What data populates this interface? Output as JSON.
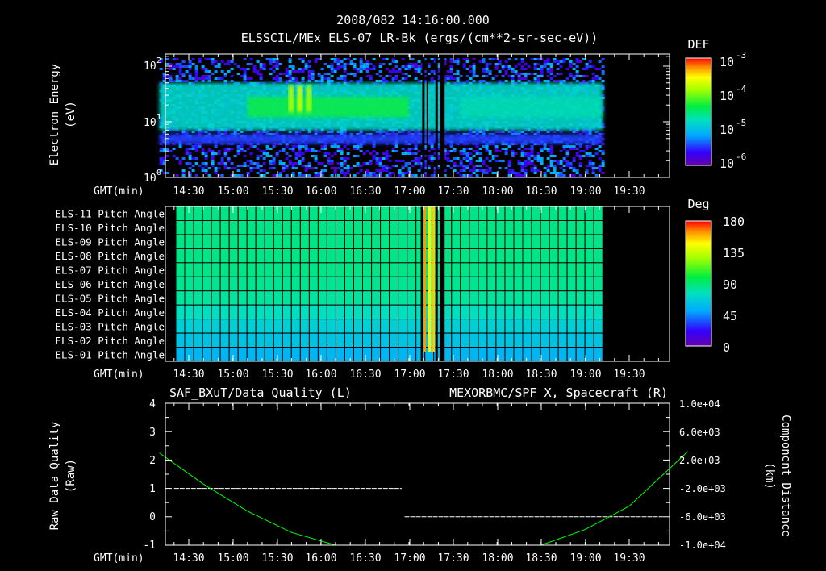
{
  "header": {
    "timestamp": "2008/082 14:16:00.000",
    "subtitle": "ELSSCIL/MEx ELS-07 LR-Bk   (ergs/(cm**2-sr-sec-eV))"
  },
  "time_axis": {
    "label": "GMT(min)",
    "ticks": [
      "14:30",
      "15:00",
      "15:30",
      "16:00",
      "16:30",
      "17:00",
      "17:30",
      "18:00",
      "18:30",
      "19:00",
      "19:30"
    ]
  },
  "panel1": {
    "ylabel_line1": "Electron Energy",
    "ylabel_line2": "(eV)",
    "yticks": [
      {
        "base": "10",
        "exp": "2"
      },
      {
        "base": "10",
        "exp": "1"
      },
      {
        "base": "10",
        "exp": "0"
      }
    ],
    "colorbar": {
      "title": "DEF",
      "labels": [
        {
          "base": "10",
          "exp": "-3"
        },
        {
          "base": "10",
          "exp": "-4"
        },
        {
          "base": "10",
          "exp": "-5"
        },
        {
          "base": "10",
          "exp": "-6"
        }
      ]
    }
  },
  "panel2": {
    "rows": [
      "ELS-11 Pitch Angle",
      "ELS-10 Pitch Angle",
      "ELS-09 Pitch Angle",
      "ELS-08 Pitch Angle",
      "ELS-07 Pitch Angle",
      "ELS-06 Pitch Angle",
      "ELS-05 Pitch Angle",
      "ELS-04 Pitch Angle",
      "ELS-03 Pitch Angle",
      "ELS-02 Pitch Angle",
      "ELS-01 Pitch Angle"
    ],
    "colorbar": {
      "title": "Deg",
      "labels": [
        "180",
        "135",
        "90",
        "45",
        "0"
      ]
    }
  },
  "panel3": {
    "left_title": "SAF_BXuT/Data Quality (L)",
    "right_title": "MEXORBMC/SPF X, Spacecraft (R)",
    "left_ylabel_line1": "Raw Data Quality",
    "left_ylabel_line2": "(Raw)",
    "right_ylabel_line1": "Component Distance",
    "right_ylabel_line2": "(km)",
    "left_ticks": [
      "4",
      "3",
      "2",
      "1",
      "0",
      "-1"
    ],
    "right_ticks": [
      "1.0e+04",
      "6.0e+03",
      "2.0e+03",
      "-2.0e+03",
      "-6.0e+03",
      "-1.0e+04"
    ],
    "colors": {
      "quality": "#ffffff",
      "spacecraft_x": "#00ff00"
    }
  },
  "chart_data": [
    {
      "type": "heatmap",
      "title": "ELSSCIL/MEx ELS-07 LR-Bk   (ergs/(cm**2-sr-sec-eV))",
      "xlabel": "GMT(min)",
      "ylabel": "Electron Energy (eV)",
      "yscale": "log",
      "ylim": [
        1,
        180
      ],
      "xlim": [
        "14:10",
        "20:10"
      ],
      "data_extent": [
        "14:10",
        "19:12"
      ],
      "colorbar": {
        "label": "DEF",
        "scale": "log",
        "range": [
          1e-06,
          0.001
        ]
      },
      "peak_energy_band_eV": [
        10,
        30
      ]
    },
    {
      "type": "heatmap",
      "xlabel": "GMT(min)",
      "rows": [
        "ELS-11",
        "ELS-10",
        "ELS-09",
        "ELS-08",
        "ELS-07",
        "ELS-06",
        "ELS-05",
        "ELS-04",
        "ELS-03",
        "ELS-02",
        "ELS-01"
      ],
      "values_deg": [
        86,
        86,
        86,
        86,
        86,
        84,
        82,
        76,
        68,
        62,
        56
      ],
      "colorbar": {
        "label": "Deg",
        "range": [
          0,
          180
        ]
      },
      "data_extent": [
        "14:10",
        "19:12"
      ]
    },
    {
      "type": "line",
      "xlabel": "GMT(min)",
      "series": [
        {
          "name": "SAF_BXuT/Data Quality (L)",
          "axis": "left",
          "x": [
            "14:20",
            "16:55",
            "16:57",
            "19:53"
          ],
          "y": [
            1,
            1,
            0,
            0
          ]
        },
        {
          "name": "MEXORBMC/SPF X, Spacecraft (R)",
          "axis": "right",
          "x": [
            "14:10",
            "14:40",
            "15:10",
            "15:40",
            "16:10",
            "16:30",
            "17:00",
            "18:00",
            "18:30",
            "19:00",
            "19:30",
            "20:10"
          ],
          "y": [
            3000,
            -1400,
            -5200,
            -8200,
            -10200,
            -10900,
            -11800,
            -11800,
            -10500,
            -7800,
            -4500,
            3200
          ]
        }
      ],
      "ylim_left": [
        -1,
        4
      ],
      "ylim_right": [
        -10000,
        10000
      ]
    }
  ]
}
